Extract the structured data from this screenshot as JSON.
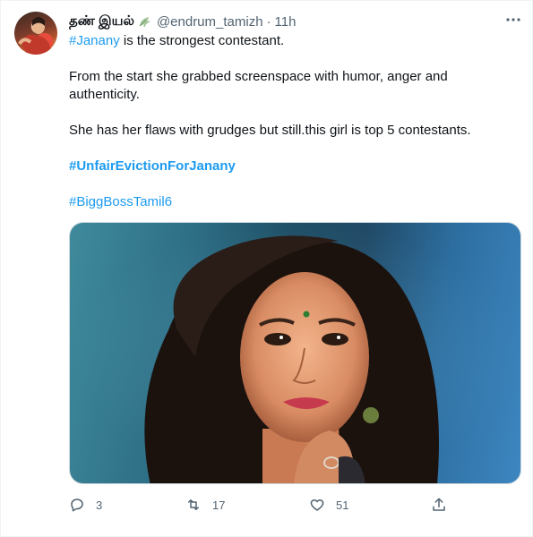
{
  "author": {
    "display_name": "தண் இயல்",
    "handle": "@endrum_tamizh",
    "separator": "·",
    "time": "11h",
    "avatar_icon": "profile-avatar",
    "name_emoji_icon": "leaf-icon"
  },
  "tweet": {
    "line1_hashtag": "#Janany",
    "line1_text": " is the strongest contestant.",
    "paragraph2": "From the start she grabbed screenspace with humor, anger and authenticity.",
    "paragraph3": "She has her flaws with grudges but still.this girl is top 5 contestants.",
    "hashtag_bold": "#UnfairEvictionForJanany",
    "hashtag_last": "#BiggBossTamil6"
  },
  "actions": {
    "reply_count": "3",
    "retweet_count": "17",
    "like_count": "51"
  },
  "colors": {
    "link": "#1d9bf0",
    "muted": "#536471",
    "text": "#0f1419"
  }
}
